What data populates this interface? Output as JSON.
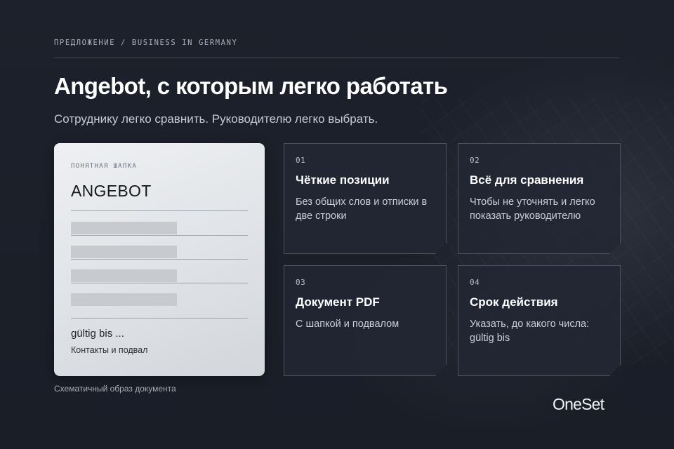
{
  "header": {
    "eyebrow": "ПРЕДЛОЖЕНИЕ / BUSINESS IN GERMANY",
    "title": "Angebot, с которым легко работать",
    "subtitle": "Сотруднику легко сравнить. Руководителю легко выбрать."
  },
  "document": {
    "kicker": "ПОНЯТНАЯ ШАПКА",
    "name": "ANGEBOT",
    "valid": "gültig bis ...",
    "footer": "Контакты и подвал",
    "caption": "Схематичный образ документа"
  },
  "cards": [
    {
      "num": "01",
      "title": "Чёткие позиции",
      "text": "Без общих слов и отписки в две строки"
    },
    {
      "num": "02",
      "title": "Всё для сравнения",
      "text": "Чтобы не уточнять и легко показать руководителю"
    },
    {
      "num": "03",
      "title": "Документ PDF",
      "text": "С шапкой и подвалом"
    },
    {
      "num": "04",
      "title": "Срок действия",
      "text": "Указать, до какого числа: gültig bis"
    }
  ],
  "logo": {
    "text": "OneSet"
  },
  "colors": {
    "background": "#1b1f29",
    "card": "#222733",
    "document": "#e3e5e9",
    "accent_text": "#ffffff"
  }
}
